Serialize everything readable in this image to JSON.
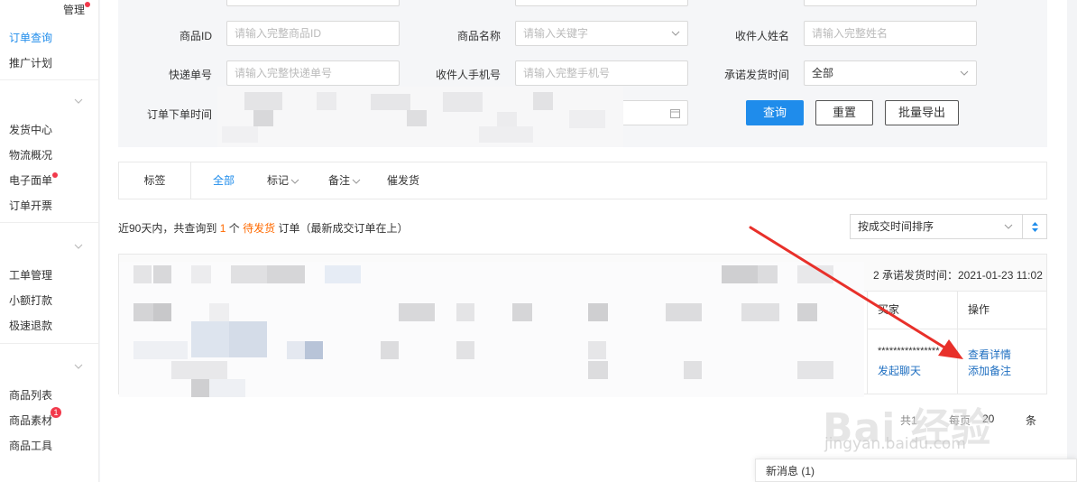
{
  "sidebar": {
    "items": [
      {
        "label": "管理",
        "dot": true
      },
      {
        "label": "订单查询",
        "active": true
      },
      {
        "label": "推广计划"
      },
      {
        "label": "发货中心"
      },
      {
        "label": "物流概况"
      },
      {
        "label": "电子面单",
        "dot": true
      },
      {
        "label": "订单开票"
      },
      {
        "label": "工单管理"
      },
      {
        "label": "小额打款"
      },
      {
        "label": "极速退款"
      },
      {
        "label": "商品列表"
      },
      {
        "label": "商品素材",
        "badge": "1"
      },
      {
        "label": "商品工具"
      }
    ]
  },
  "filters": {
    "product_id": {
      "label": "商品ID",
      "placeholder": "请输入完整商品ID"
    },
    "product_name": {
      "label": "商品名称",
      "placeholder": "请输入关键字"
    },
    "receiver_name": {
      "label": "收件人姓名",
      "placeholder": "请输入完整姓名"
    },
    "tracking_no": {
      "label": "快递单号",
      "placeholder": "请输入完整快递单号"
    },
    "receiver_phone": {
      "label": "收件人手机号",
      "placeholder": "请输入完整手机号"
    },
    "promise_time": {
      "label": "承诺发货时间",
      "value": "全部"
    },
    "order_time": {
      "label": "订单下单时间"
    }
  },
  "buttons": {
    "search": "查询",
    "reset": "重置",
    "export": "批量导出"
  },
  "tabs": {
    "head": "标签",
    "items": [
      "全部",
      "标记",
      "备注",
      "催发货"
    ]
  },
  "summary": {
    "prefix": "近90天内，共查询到",
    "count": "1",
    "mid": "个",
    "status": "待发货",
    "suffix": "订单（最新成交订单在上）"
  },
  "sort": {
    "value": "按成交时间排序"
  },
  "order_card": {
    "promise_time": "2  承诺发货时间：2021-01-23 11:02",
    "col_buyer": "买家",
    "col_action": "操作",
    "buyer_name": "****************",
    "start_chat": "发起聊天",
    "view_detail": "查看详情",
    "add_note": "添加备注"
  },
  "pager": {
    "left": "共1",
    "mid": "每页",
    "size": "20",
    "unit": "条"
  },
  "message_bar": {
    "label": "新消息 (1)"
  },
  "watermark": {
    "logo": "Bai 经验",
    "url": "jingyan.baidu.com"
  },
  "colors": {
    "accent": "#1f8ceb",
    "highlight": "#ff6a00",
    "arrow": "#e8302a",
    "badge": "#f2394b"
  }
}
